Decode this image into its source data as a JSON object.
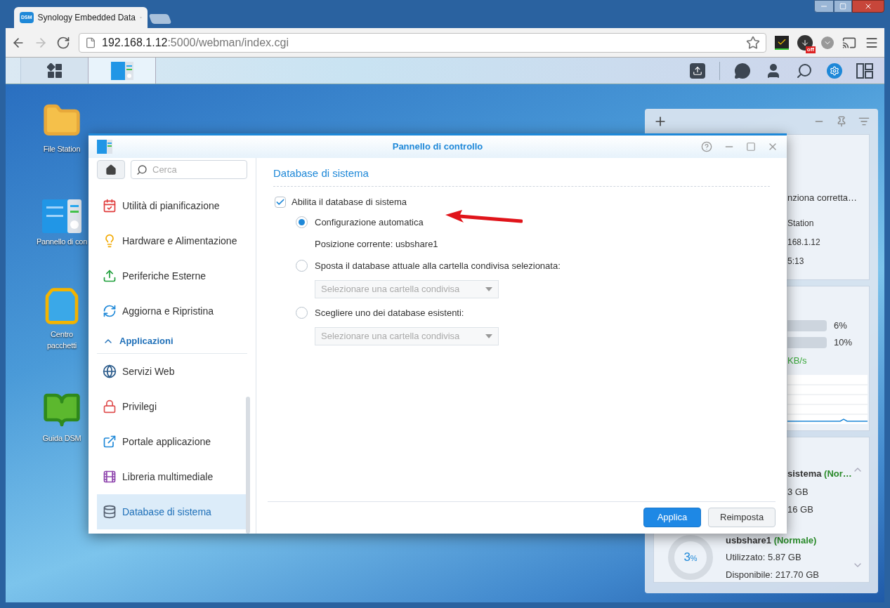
{
  "browser": {
    "tab": {
      "favicon_text": "DSM",
      "title": "Synology Embedded Data"
    },
    "url_host": "192.168.1.12",
    "url_path": ":5000/webman/index.cgi",
    "download_badge": "off"
  },
  "taskbar_apps": [
    {
      "kind": "main-menu",
      "selected": false
    },
    {
      "kind": "control-panel",
      "selected": true
    }
  ],
  "desktop_icons": [
    {
      "kind": "folder",
      "label": "File Station"
    },
    {
      "kind": "control-panel",
      "label": "Pannello di con"
    },
    {
      "kind": "bag",
      "label": "Centro pacchetti"
    },
    {
      "kind": "help-book",
      "label": "Guida DSM"
    }
  ],
  "window": {
    "title": "Pannello di controllo",
    "sidebar": {
      "search_placeholder": "Cerca",
      "items": [
        {
          "kind": "item",
          "label": "Utilità di pianificazione",
          "selected": false
        },
        {
          "kind": "item",
          "label": "Hardware e Alimentazione",
          "selected": false
        },
        {
          "kind": "item",
          "label": "Periferiche Esterne",
          "selected": false
        },
        {
          "kind": "item",
          "label": "Aggiorna e Ripristina",
          "selected": false
        },
        {
          "kind": "header",
          "label": "Applicazioni",
          "expanded": true
        },
        {
          "kind": "item",
          "label": "Servizi Web",
          "selected": false
        },
        {
          "kind": "item",
          "label": "Privilegi",
          "selected": false
        },
        {
          "kind": "item",
          "label": "Portale applicazione",
          "selected": false
        },
        {
          "kind": "item",
          "label": "Libreria multimediale",
          "selected": false
        },
        {
          "kind": "item",
          "label": "Database di sistema",
          "selected": true
        }
      ]
    },
    "heading": "Database di sistema",
    "enable": {
      "label": "Abilita il database di sistema",
      "checked": true
    },
    "options": [
      {
        "kind": "radio",
        "label": "Configurazione automatica",
        "selected": true
      },
      {
        "kind": "note",
        "label": "Posizione corrente: usbshare1"
      },
      {
        "kind": "radio",
        "label": "Sposta il database attuale alla cartella condivisa selezionata:",
        "selected": false
      },
      {
        "kind": "select",
        "placeholder": "Selezionare una cartella condivisa",
        "disabled": true
      },
      {
        "kind": "radio",
        "label": "Scegliere uno dei database esistenti:",
        "selected": false
      },
      {
        "kind": "select",
        "placeholder": "Selezionare una cartella condivisa",
        "disabled": true
      }
    ],
    "buttons": [
      {
        "kind": "primary",
        "label": "Applica"
      },
      {
        "kind": "secondary",
        "label": "Reimposta"
      }
    ]
  },
  "widgets": {
    "health": [
      "nziona corretta…",
      "Station",
      "168.1.12",
      "5:13"
    ],
    "resources": {
      "rows": [
        {
          "reading": "6%"
        },
        {
          "reading": "10%"
        }
      ],
      "speed": "KB/s"
    },
    "storage": {
      "volume_name": "sistema ",
      "volume_status": "(Nor…",
      "volume_lines": [
        "3 GB",
        "16 GB"
      ],
      "usb_percent": "3",
      "usb_percent_unit": "%",
      "usb_name": "usbshare1 ",
      "usb_status": "(Normale)",
      "usb_lines": [
        "Utilizzato: 5.87 GB",
        "Disponibile: 217.70 GB"
      ]
    }
  }
}
